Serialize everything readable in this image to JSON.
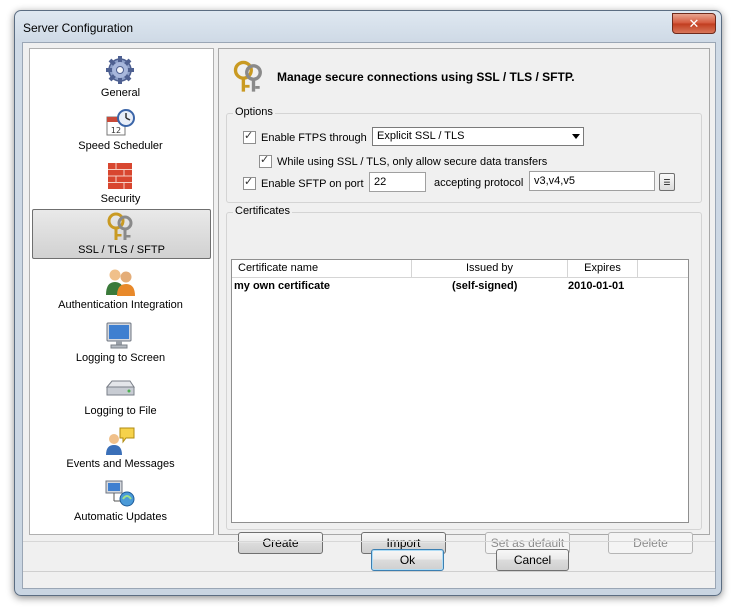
{
  "window": {
    "title": "Server Configuration",
    "close_symbol": "✕"
  },
  "sidebar": {
    "items": [
      {
        "label": "General",
        "icon": "gear-icon"
      },
      {
        "label": "Speed Scheduler",
        "icon": "clock-calendar-icon"
      },
      {
        "label": "Security",
        "icon": "firewall-icon"
      },
      {
        "label": "SSL / TLS / SFTP",
        "icon": "keys-icon",
        "selected": true
      },
      {
        "label": "Authentication Integration",
        "icon": "users-icon"
      },
      {
        "label": "Logging to Screen",
        "icon": "monitor-icon"
      },
      {
        "label": "Logging to File",
        "icon": "drive-icon"
      },
      {
        "label": "Events and Messages",
        "icon": "messages-icon"
      },
      {
        "label": "Automatic Updates",
        "icon": "network-update-icon"
      }
    ]
  },
  "main": {
    "header_text": "Manage secure connections using SSL / TLS / SFTP.",
    "options": {
      "group_label": "Options",
      "ftps_label": "Enable FTPS through",
      "ftps_checked": true,
      "ftps_mode": "Explicit SSL / TLS",
      "secure_data_label": "While using SSL / TLS, only allow secure data transfers",
      "secure_data_checked": true,
      "sftp_label": "Enable SFTP on port",
      "sftp_checked": true,
      "sftp_port": "22",
      "protocol_label": "accepting protocol",
      "protocol_value": "v3,v4,v5"
    },
    "certificates": {
      "group_label": "Certificates",
      "columns": [
        "Certificate name",
        "Issued by",
        "Expires"
      ],
      "rows": [
        {
          "name": "my own certificate",
          "issued_by": "(self-signed)",
          "expires": "2010-01-01"
        }
      ],
      "buttons": {
        "create": "Create",
        "import": "Import",
        "set_default": "Set as default",
        "delete": "Delete"
      }
    }
  },
  "footer": {
    "ok": "Ok",
    "cancel": "Cancel"
  }
}
